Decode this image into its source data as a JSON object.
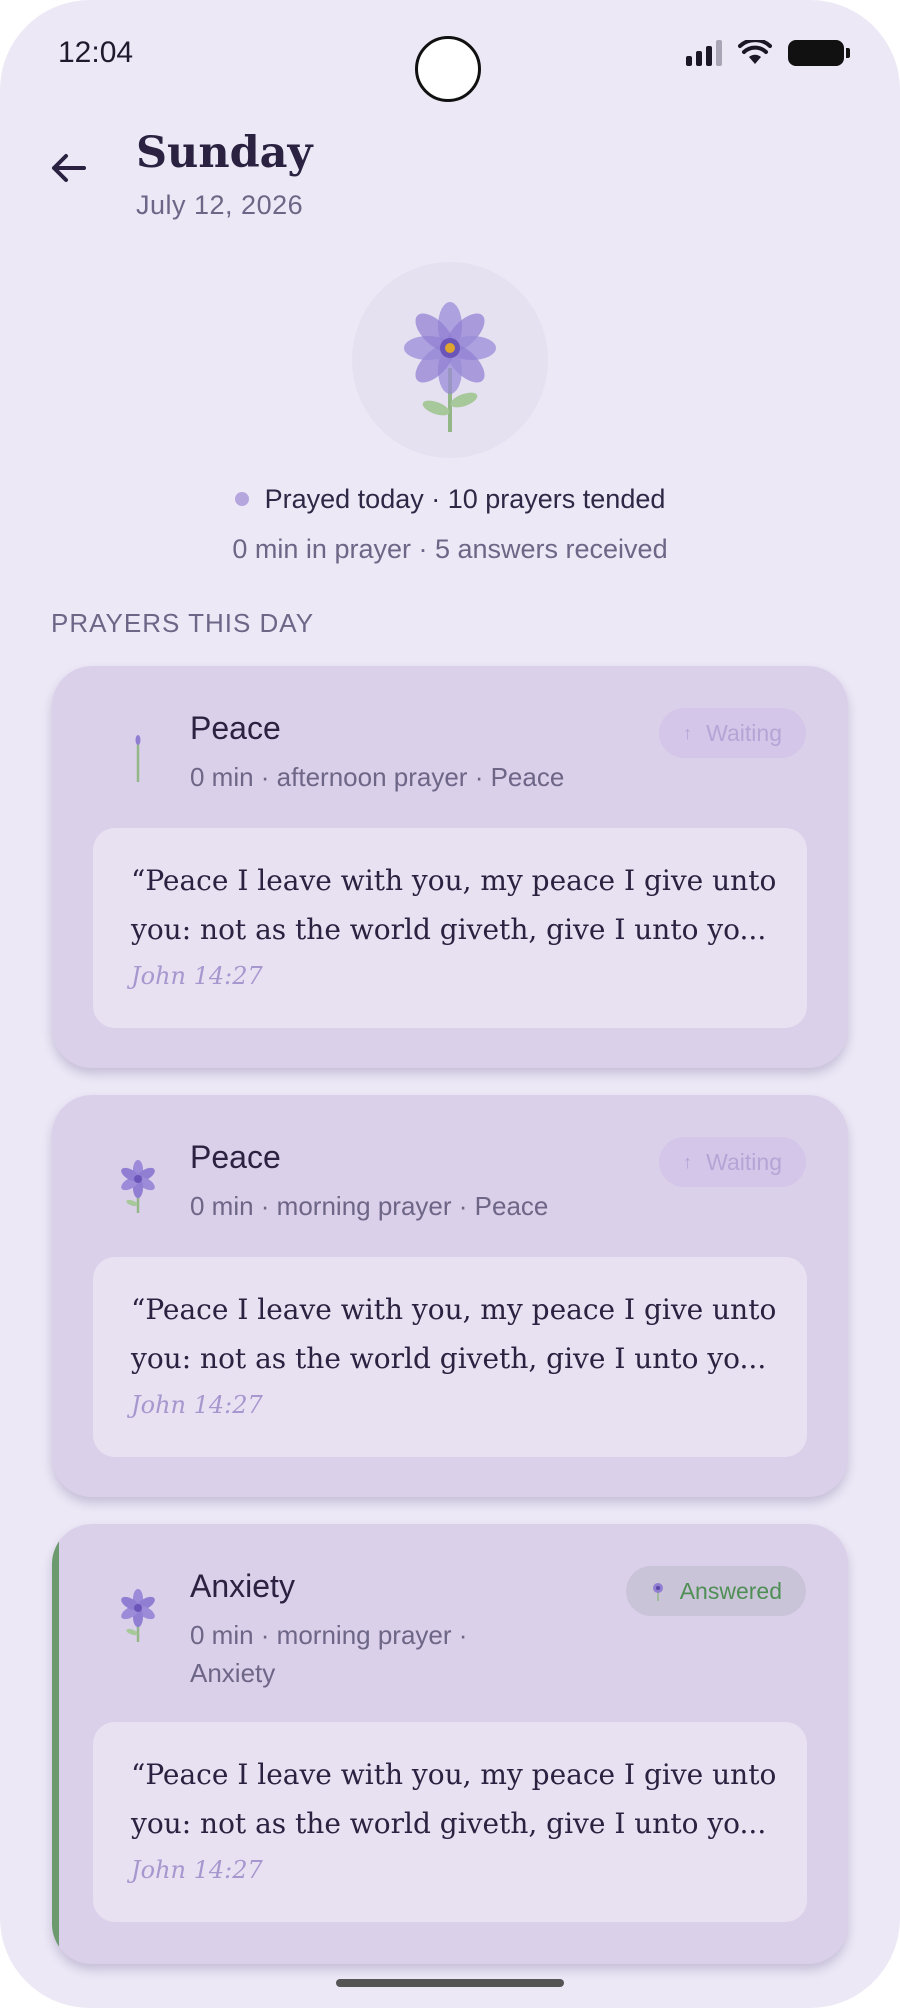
{
  "status_bar": {
    "time": "12:04",
    "icons": [
      "signal-icon",
      "wifi-icon",
      "battery-icon"
    ]
  },
  "header": {
    "title": "Sunday",
    "date": "July 12, 2026",
    "back_icon": "arrow-left-icon"
  },
  "summary": {
    "line1": "Prayed today · 10 prayers tended",
    "line2": "0 min in prayer · 5 answers received"
  },
  "section_title": "PRAYERS THIS DAY",
  "prayers": [
    {
      "title": "Peace",
      "meta": "0 min · afternoon prayer · Peace",
      "status": "Waiting",
      "status_icon": "arrow-up-icon",
      "plant_icon": "sprout-icon",
      "verse": "“Peace I leave with you, my peace I give unto you: not as the world giveth, give I unto yo...",
      "reference": "John 14:27"
    },
    {
      "title": "Peace",
      "meta": "0 min · morning prayer · Peace",
      "status": "Waiting",
      "status_icon": "arrow-up-icon",
      "plant_icon": "flower-icon",
      "verse": "“Peace I leave with you, my peace I give unto you: not as the world giveth, give I unto yo...",
      "reference": "John 14:27"
    },
    {
      "title": "Anxiety",
      "meta": "0 min · morning prayer · Anxiety",
      "status": "Answered",
      "status_icon": "flower-icon",
      "plant_icon": "flower-icon",
      "verse": "“Peace I leave with you, my peace I give unto you: not as the world giveth, give I unto yo...",
      "reference": "John 14:27"
    }
  ],
  "colors": {
    "background": "#ece8f6",
    "card": "#dbd0ea",
    "accent": "#b6a6de",
    "answered": "#4f8f55"
  }
}
